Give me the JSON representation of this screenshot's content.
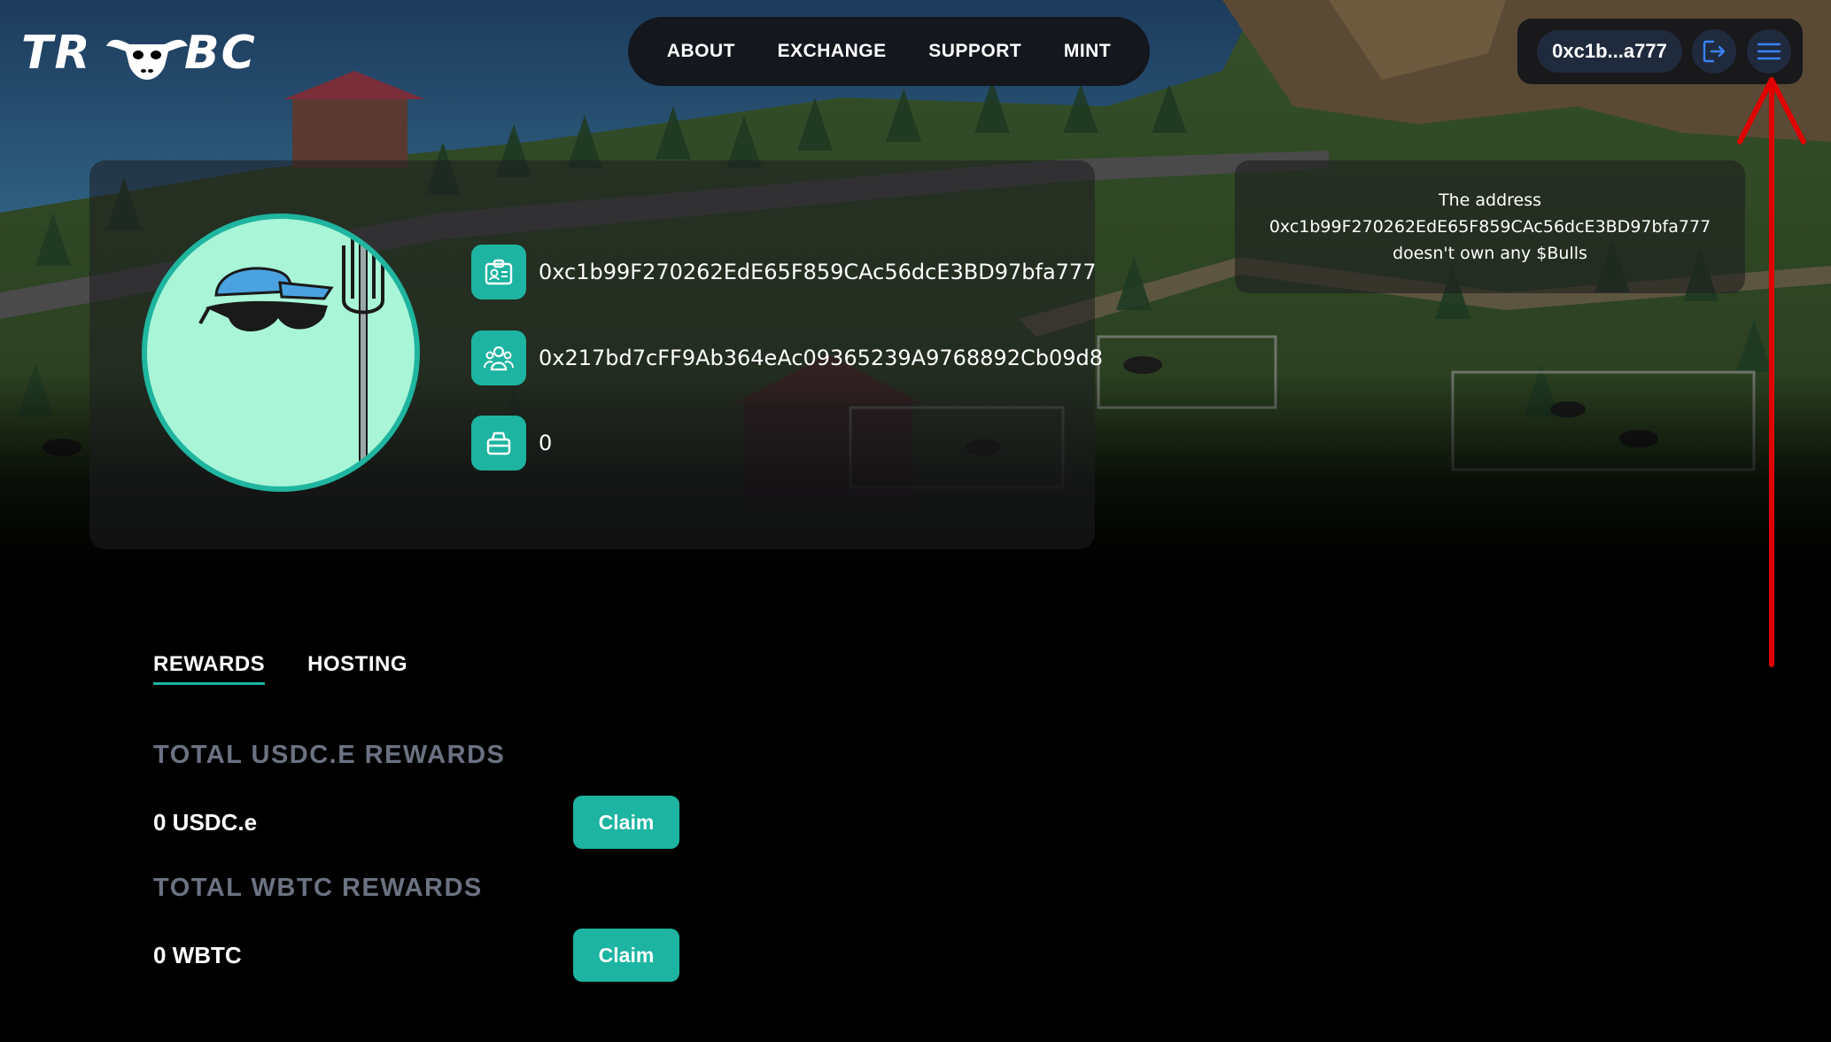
{
  "header": {
    "logo": {
      "left_text": "TR",
      "right_text": "BC"
    },
    "nav": [
      "ABOUT",
      "EXCHANGE",
      "SUPPORT",
      "MINT"
    ],
    "wallet_label": "0xc1b...a777"
  },
  "profile": {
    "wallet_address": "0xc1b99F270262EdE65F859CAc56dcE3BD97bfa777",
    "referrer_address": "0x217bd7cFF9Ab364eAc09365239A9768892Cb09d8",
    "balance": "0"
  },
  "notice": {
    "line1": "The address",
    "line2": "0xc1b99F270262EdE65F859CAc56dcE3BD97bfa777",
    "line3": "doesn't own any $Bulls"
  },
  "tabs": [
    "REWARDS",
    "HOSTING"
  ],
  "rewards": [
    {
      "heading": "TOTAL USDC.E REWARDS",
      "amount": "0 USDC.e",
      "button": "Claim"
    },
    {
      "heading": "TOTAL WBTC REWARDS",
      "amount": "0 WBTC",
      "button": "Claim"
    }
  ],
  "colors": {
    "accent": "#1db4a1",
    "muted_heading": "#6b7282",
    "annotation": "#e00000",
    "avatar_bg": "#a9f5d8"
  }
}
